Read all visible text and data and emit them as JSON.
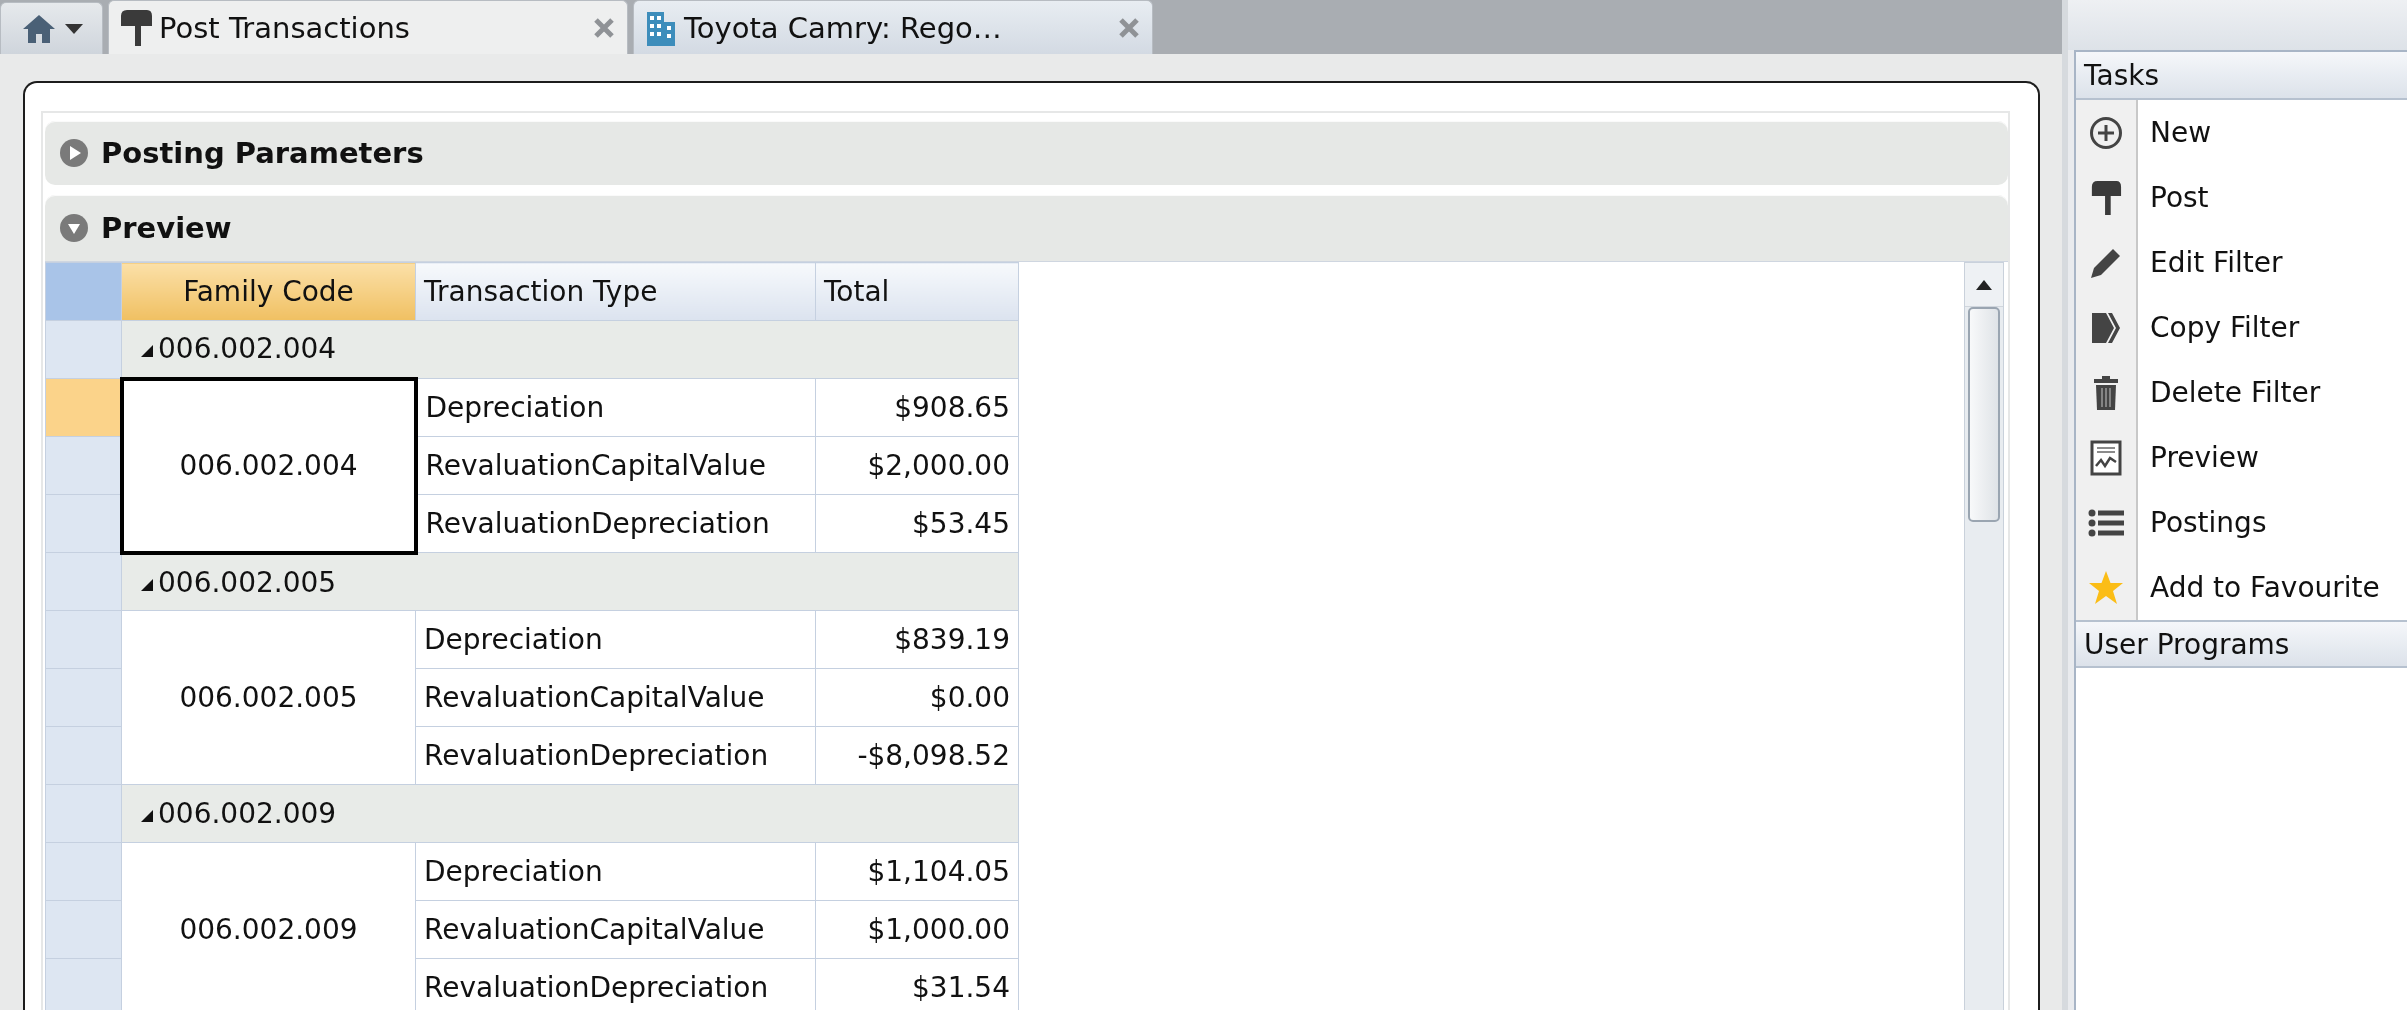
{
  "tabs": [
    {
      "kind": "mailbox",
      "label": "Post Transactions",
      "selected": true
    },
    {
      "kind": "building",
      "label": "Toyota Camry: Rego…",
      "selected": false
    }
  ],
  "sections": [
    {
      "title": "Posting Parameters",
      "expanded": false
    },
    {
      "title": "Preview",
      "expanded": true
    }
  ],
  "grid": {
    "columns": [
      "Family Code",
      "Transaction Type",
      "Total"
    ],
    "groups": [
      {
        "code": "006.002.004",
        "cell_code": "006.002.004",
        "expanded": true,
        "focused": true,
        "rows": [
          {
            "type": "Depreciation",
            "total": "$908.65",
            "selected": true
          },
          {
            "type": "RevaluationCapitalValue",
            "total": "$2,000.00",
            "selected": false
          },
          {
            "type": "RevaluationDepreciation",
            "total": "$53.45",
            "selected": false
          }
        ]
      },
      {
        "code": "006.002.005",
        "cell_code": "006.002.005",
        "expanded": true,
        "focused": false,
        "rows": [
          {
            "type": "Depreciation",
            "total": "$839.19",
            "selected": false
          },
          {
            "type": "RevaluationCapitalValue",
            "total": "$0.00",
            "selected": false
          },
          {
            "type": "RevaluationDepreciation",
            "total": "-$8,098.52",
            "selected": false
          }
        ]
      },
      {
        "code": "006.002.009",
        "cell_code": "006.002.009",
        "expanded": true,
        "focused": false,
        "rows": [
          {
            "type": "Depreciation",
            "total": "$1,104.05",
            "selected": false
          },
          {
            "type": "RevaluationCapitalValue",
            "total": "$1,000.00",
            "selected": false
          },
          {
            "type": "RevaluationDepreciation",
            "total": "$31.54",
            "selected": false
          }
        ]
      }
    ]
  },
  "tasks": {
    "title": "Tasks",
    "items": [
      {
        "kind": "new",
        "label": "New"
      },
      {
        "kind": "post",
        "label": "Post"
      },
      {
        "kind": "edit",
        "label": "Edit Filter"
      },
      {
        "kind": "copy",
        "label": "Copy Filter"
      },
      {
        "kind": "delete",
        "label": "Delete Filter"
      },
      {
        "kind": "preview",
        "label": "Preview"
      },
      {
        "kind": "list",
        "label": "Postings"
      },
      {
        "kind": "favourite",
        "label": "Add to Favourite"
      }
    ]
  },
  "user_programs": {
    "title": "User Programs"
  }
}
